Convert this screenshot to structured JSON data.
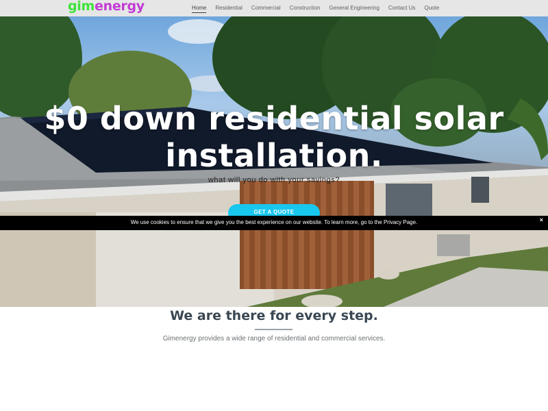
{
  "header": {
    "logo_part1": "gim",
    "logo_part2": "energy",
    "logo_colors": {
      "part1": "#3ee33b",
      "part2": "#c23bd3"
    },
    "nav": [
      {
        "label": "Home",
        "active": true
      },
      {
        "label": "Residential"
      },
      {
        "label": "Commercial"
      },
      {
        "label": "Construction"
      },
      {
        "label": "General Engineering"
      },
      {
        "label": "Contact Us"
      },
      {
        "label": "Quote"
      }
    ]
  },
  "hero": {
    "title_line1": "$0 down residential solar",
    "title_line2": "installation.",
    "subtitle": "what will you do with your savings?",
    "cta_label": "GET A QUOTE",
    "accent_color": "#18c7ee"
  },
  "cookie": {
    "message": "We use cookies to ensure that we give you the best experience on our website. To learn more, go to the Privacy Page.",
    "close_icon": "×"
  },
  "section": {
    "title": "We are there for every step.",
    "text": "Gimenergy provides a wide range of residential and commercial services."
  }
}
